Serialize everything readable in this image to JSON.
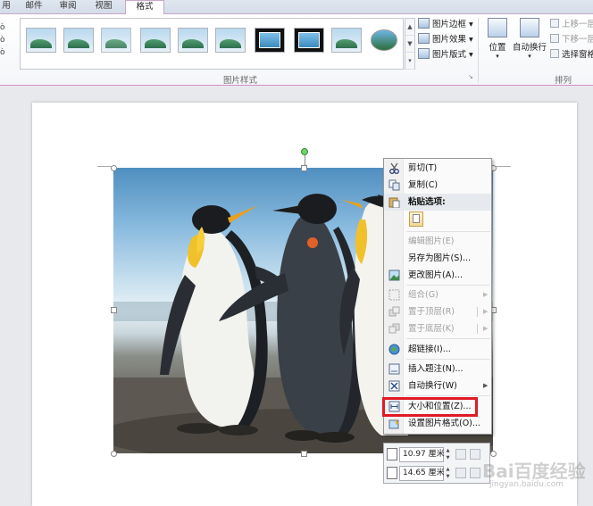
{
  "ribbon": {
    "tabs": [
      {
        "label": "用",
        "active": false
      },
      {
        "label": "邮件",
        "active": false
      },
      {
        "label": "审阅",
        "active": false
      },
      {
        "label": "视图",
        "active": false
      },
      {
        "label": "格式",
        "active": true
      }
    ],
    "left_stub": [
      "ò",
      "ò",
      "ò"
    ],
    "picture_styles_group_label": "图片样式",
    "style_buttons": {
      "border": "图片边框",
      "effects": "图片效果",
      "layout": "图片版式"
    },
    "arrange": {
      "group_label": "排列",
      "position": "位置",
      "wrap_text": "自动换行",
      "bring_forward": "上移一层",
      "send_backward": "下移一层",
      "selection_pane": "选择窗格"
    }
  },
  "context_menu": {
    "items": [
      {
        "id": "cut",
        "label": "剪切(T)",
        "disabled": false
      },
      {
        "id": "copy",
        "label": "复制(C)",
        "disabled": false
      },
      {
        "id": "paste-options",
        "label": "粘贴选项:",
        "header": true
      },
      {
        "id": "edit-picture",
        "label": "编辑图片(E)",
        "disabled": true
      },
      {
        "id": "save-as-picture",
        "label": "另存为图片(S)...",
        "disabled": false
      },
      {
        "id": "change-picture",
        "label": "更改图片(A)...",
        "disabled": false
      },
      {
        "id": "group",
        "label": "组合(G)",
        "disabled": true
      },
      {
        "id": "bring-to-front",
        "label": "置于顶层(R)",
        "disabled": true
      },
      {
        "id": "send-to-back",
        "label": "置于底层(K)",
        "disabled": true
      },
      {
        "id": "hyperlink",
        "label": "超链接(I)...",
        "disabled": false
      },
      {
        "id": "insert-caption",
        "label": "插入题注(N)...",
        "disabled": false
      },
      {
        "id": "wrap-text",
        "label": "自动换行(W)",
        "disabled": false
      },
      {
        "id": "size-and-position",
        "label": "大小和位置(Z)...",
        "disabled": false,
        "highlighted": true
      },
      {
        "id": "format-picture",
        "label": "设置图片格式(O)...",
        "disabled": false
      }
    ]
  },
  "mini_toolbar": {
    "height_value": "10.97 厘米",
    "width_value": "14.65 厘米"
  },
  "watermark": {
    "text": "Bai百度经验",
    "sub": "jingyan.baidu.com"
  }
}
